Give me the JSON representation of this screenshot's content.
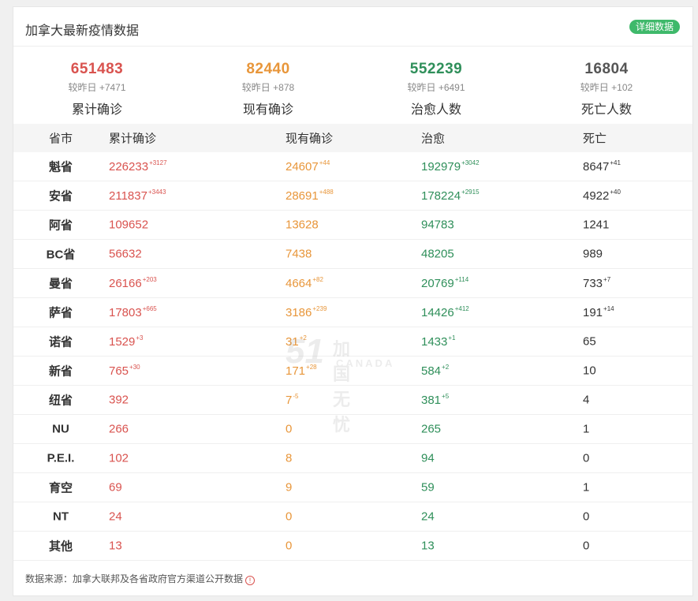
{
  "header": {
    "title": "加拿大最新疫情数据",
    "detail_button": "详细数据"
  },
  "colors": {
    "confirmed": "#d9534f",
    "current": "#e8963a",
    "recovered": "#2f8f5a",
    "deaths": "#555555",
    "accent": "#3fb96b"
  },
  "summary": [
    {
      "value": "651483",
      "delta_label": "较昨日",
      "delta": "+7471",
      "label": "累计确诊",
      "color": "#d9534f"
    },
    {
      "value": "82440",
      "delta_label": "较昨日",
      "delta": "+878",
      "label": "现有确诊",
      "color": "#e8963a"
    },
    {
      "value": "552239",
      "delta_label": "较昨日",
      "delta": "+6491",
      "label": "治愈人数",
      "color": "#2f8f5a"
    },
    {
      "value": "16804",
      "delta_label": "较昨日",
      "delta": "+102",
      "label": "死亡人数",
      "color": "#555555"
    }
  ],
  "table": {
    "headers": [
      "省市",
      "累计确诊",
      "现有确诊",
      "治愈",
      "死亡"
    ],
    "rows": [
      {
        "name": "魁省",
        "confirmed": "226233",
        "confirmed_inc": "+3127",
        "current": "24607",
        "current_inc": "+44",
        "recovered": "192979",
        "recovered_inc": "+3042",
        "deaths": "8647",
        "deaths_inc": "+41"
      },
      {
        "name": "安省",
        "confirmed": "211837",
        "confirmed_inc": "+3443",
        "current": "28691",
        "current_inc": "+488",
        "recovered": "178224",
        "recovered_inc": "+2915",
        "deaths": "4922",
        "deaths_inc": "+40"
      },
      {
        "name": "阿省",
        "confirmed": "109652",
        "confirmed_inc": "",
        "current": "13628",
        "current_inc": "",
        "recovered": "94783",
        "recovered_inc": "",
        "deaths": "1241",
        "deaths_inc": ""
      },
      {
        "name": "BC省",
        "confirmed": "56632",
        "confirmed_inc": "",
        "current": "7438",
        "current_inc": "",
        "recovered": "48205",
        "recovered_inc": "",
        "deaths": "989",
        "deaths_inc": ""
      },
      {
        "name": "曼省",
        "confirmed": "26166",
        "confirmed_inc": "+203",
        "current": "4664",
        "current_inc": "+82",
        "recovered": "20769",
        "recovered_inc": "+114",
        "deaths": "733",
        "deaths_inc": "+7"
      },
      {
        "name": "萨省",
        "confirmed": "17803",
        "confirmed_inc": "+665",
        "current": "3186",
        "current_inc": "+239",
        "recovered": "14426",
        "recovered_inc": "+412",
        "deaths": "191",
        "deaths_inc": "+14"
      },
      {
        "name": "诺省",
        "confirmed": "1529",
        "confirmed_inc": "+3",
        "current": "31",
        "current_inc": "+2",
        "recovered": "1433",
        "recovered_inc": "+1",
        "deaths": "65",
        "deaths_inc": ""
      },
      {
        "name": "新省",
        "confirmed": "765",
        "confirmed_inc": "+30",
        "current": "171",
        "current_inc": "+28",
        "recovered": "584",
        "recovered_inc": "+2",
        "deaths": "10",
        "deaths_inc": ""
      },
      {
        "name": "纽省",
        "confirmed": "392",
        "confirmed_inc": "",
        "current": "7",
        "current_inc": "-5",
        "recovered": "381",
        "recovered_inc": "+5",
        "deaths": "4",
        "deaths_inc": ""
      },
      {
        "name": "NU",
        "confirmed": "266",
        "confirmed_inc": "",
        "current": "0",
        "current_inc": "",
        "recovered": "265",
        "recovered_inc": "",
        "deaths": "1",
        "deaths_inc": ""
      },
      {
        "name": "P.E.I.",
        "confirmed": "102",
        "confirmed_inc": "",
        "current": "8",
        "current_inc": "",
        "recovered": "94",
        "recovered_inc": "",
        "deaths": "0",
        "deaths_inc": ""
      },
      {
        "name": "育空",
        "confirmed": "69",
        "confirmed_inc": "",
        "current": "9",
        "current_inc": "",
        "recovered": "59",
        "recovered_inc": "",
        "deaths": "1",
        "deaths_inc": ""
      },
      {
        "name": "NT",
        "confirmed": "24",
        "confirmed_inc": "",
        "current": "0",
        "current_inc": "",
        "recovered": "24",
        "recovered_inc": "",
        "deaths": "0",
        "deaths_inc": ""
      },
      {
        "name": "其他",
        "confirmed": "13",
        "confirmed_inc": "",
        "current": "0",
        "current_inc": "",
        "recovered": "13",
        "recovered_inc": "",
        "deaths": "0",
        "deaths_inc": ""
      }
    ]
  },
  "watermark": {
    "big": "51",
    "cn": "加国无忧",
    "en": "CANADA"
  },
  "footer": {
    "text": "数据来源：加拿大联邦及各省政府官方渠道公开数据",
    "icon": "info-icon"
  }
}
